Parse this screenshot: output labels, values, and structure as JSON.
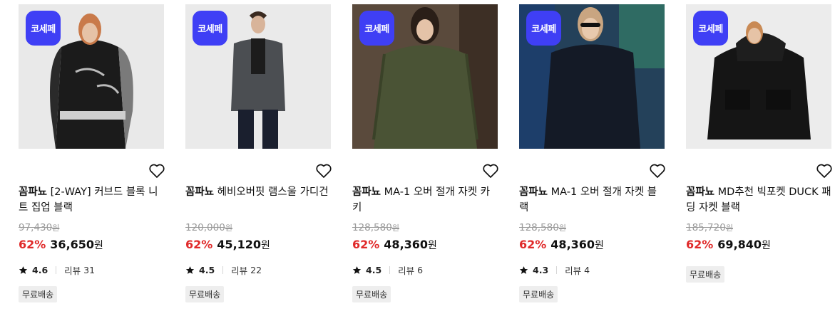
{
  "badge_label": "코세페",
  "currency_unit": "원",
  "tag_free_shipping": "무료배송",
  "review_label": "리뷰",
  "products": [
    {
      "brand": "꼼파뇨",
      "name": "[2-WAY] 커브드 블록 니트 집업 블랙",
      "original_price": "97,430",
      "discount": "62%",
      "price": "36,650",
      "rating": "4.6",
      "reviews": "31"
    },
    {
      "brand": "꼼파뇨",
      "name": "헤비오버핏 램스울 가디건",
      "original_price": "120,000",
      "discount": "62%",
      "price": "45,120",
      "rating": "4.5",
      "reviews": "22"
    },
    {
      "brand": "꼼파뇨",
      "name": "MA-1 오버 절개 자켓 카키",
      "original_price": "128,580",
      "discount": "62%",
      "price": "48,360",
      "rating": "4.5",
      "reviews": "6"
    },
    {
      "brand": "꼼파뇨",
      "name": "MA-1 오버 절개 자켓 블랙",
      "original_price": "128,580",
      "discount": "62%",
      "price": "48,360",
      "rating": "4.3",
      "reviews": "4"
    },
    {
      "brand": "꼼파뇨",
      "name": "MD추천 빅포켓 DUCK 패딩 자켓 블랙",
      "original_price": "185,720",
      "discount": "62%",
      "price": "69,840",
      "rating": "",
      "reviews": ""
    }
  ],
  "colors": {
    "badge": "#3f3ff5",
    "discount": "#e02a2a",
    "tag_bg": "#eeeeee"
  }
}
